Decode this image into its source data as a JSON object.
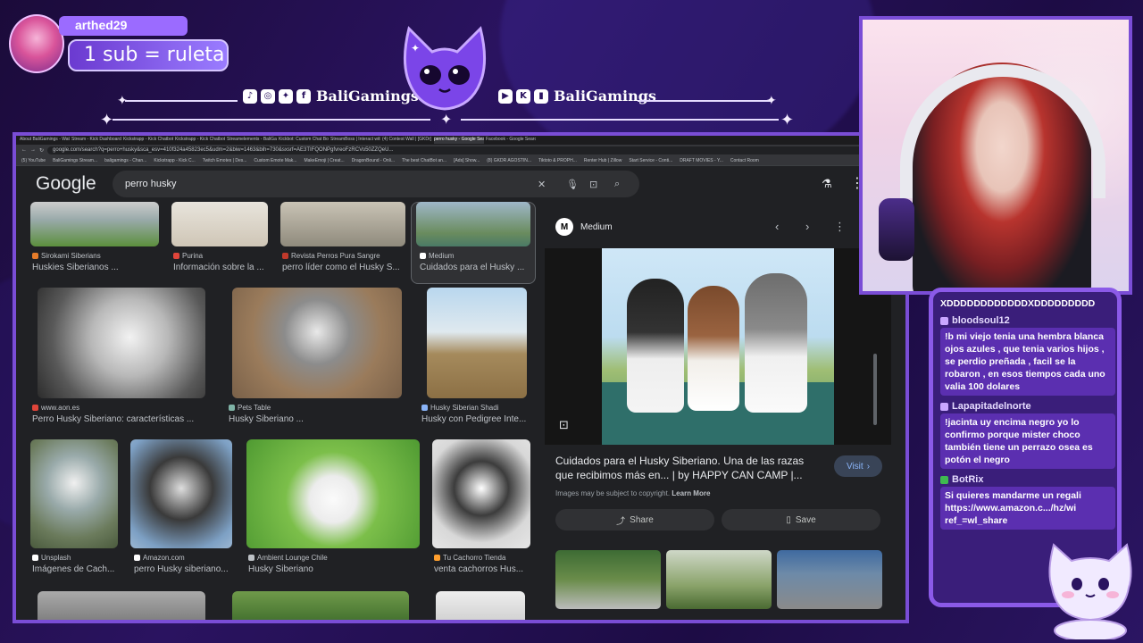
{
  "overlay": {
    "username": "arthed29",
    "goal": "1 sub = ruleta",
    "left_channel": "BaliGamings",
    "right_channel": "BaliGamings",
    "left_icons": [
      "tiktok-icon",
      "instagram-icon",
      "twitter-icon",
      "facebook-icon"
    ],
    "right_icons": [
      "youtube-icon",
      "kick-icon",
      "twitch-icon"
    ]
  },
  "browser": {
    "tabs": [
      "About BaliGamings - Watch Live",
      "Stream - Kick Dashboard",
      "Kickstrapp - Kick Chatbot and Ov...",
      "Kickstrapp - Kick Chatbot and Ov...",
      "Streamelements - BaliGamings",
      "Kickbot: Custom Chat Bot with...",
      "StreamBoss | Interact with the ...",
      "(4) Contest Wall | [GKDr] ...",
      "perro husky - Google Search",
      "Facebook - Google Search"
    ],
    "active_tab": 8,
    "url": "google.com/search?q=perro+husky&sca_esv=410f324a45823ec5&udm=2&biw=1463&bih=730&sxsrf=AE3TIFQONPgfvreoFzRCVo50ZZQeU...",
    "bookmarks": [
      "(5) YouTube",
      "BaliGamings Stream...",
      "baligamings - Chan...",
      "Kickstrapp - Kick C...",
      "Twitch Emotes | Des...",
      "Custom Emote Mak...",
      "MakeEmoji | Creat...",
      "DragonBound - Onli...",
      "The best ChatBot an...",
      "[Ads] Show...",
      "(8) GKDR AGOSTIN...",
      "Tiktoto & PROPH...",
      "Renter Hub | Zillow",
      "Start Service - Conti...",
      "DRAFT MOVIES - Y...",
      "Contact Room"
    ]
  },
  "google": {
    "logo": "Google",
    "query": "perro husky"
  },
  "results": [
    {
      "source": "Sirokami Siberians",
      "title": "Huskies Siberianos ..."
    },
    {
      "source": "Purina",
      "title": "Información sobre la ..."
    },
    {
      "source": "Revista Perros Pura Sangre",
      "title": "perro líder como el Husky S..."
    },
    {
      "source": "Medium",
      "title": "Cuidados para el Husky ..."
    },
    {
      "source": "www.aon.es",
      "title": "Perro Husky Siberiano: características ..."
    },
    {
      "source": "Pets Table",
      "title": "Husky Siberiano ..."
    },
    {
      "source": "Husky Siberian Shadi",
      "title": "Husky con Pedigree Inte..."
    },
    {
      "source": "Unsplash",
      "title": "Imágenes de Cach..."
    },
    {
      "source": "Amazon.com",
      "title": "perro Husky siberiano..."
    },
    {
      "source": "Ambient Lounge Chile",
      "title": "Husky Siberiano"
    },
    {
      "source": "Tu Cachorro Tienda",
      "title": "venta cachorros Hus..."
    }
  ],
  "panel": {
    "source": "Medium",
    "title": "Cuidados para el Husky Siberiano. Una de las razas que recibimos más en... | by HAPPY CAN CAMP |...",
    "visit_label": "Visit",
    "copyright": "Images may be subject to copyright.",
    "learn_more": "Learn More",
    "share_label": "Share",
    "save_label": "Save"
  },
  "chat": [
    {
      "user": "",
      "text": "XDDDDDDDDDDDDXDDDDDDDDD"
    },
    {
      "user": "bloodsoul12",
      "text": "!b mi viejo tenia una hembra blanca ojos azules , que tenia varios hijos , se perdio preñada , facil se la robaron , en esos tiempos cada uno valia 100 dolares"
    },
    {
      "user": "Lapapitadelnorte",
      "text": "!jacinta uy encima negro yo lo confirmo porque mister choco también tiene un perrazo osea es potón el negro"
    },
    {
      "user": "BotRix",
      "text": "Si quieres mandarme un regali https://www.amazon.c.../hz/wi ref_=wl_share"
    }
  ]
}
